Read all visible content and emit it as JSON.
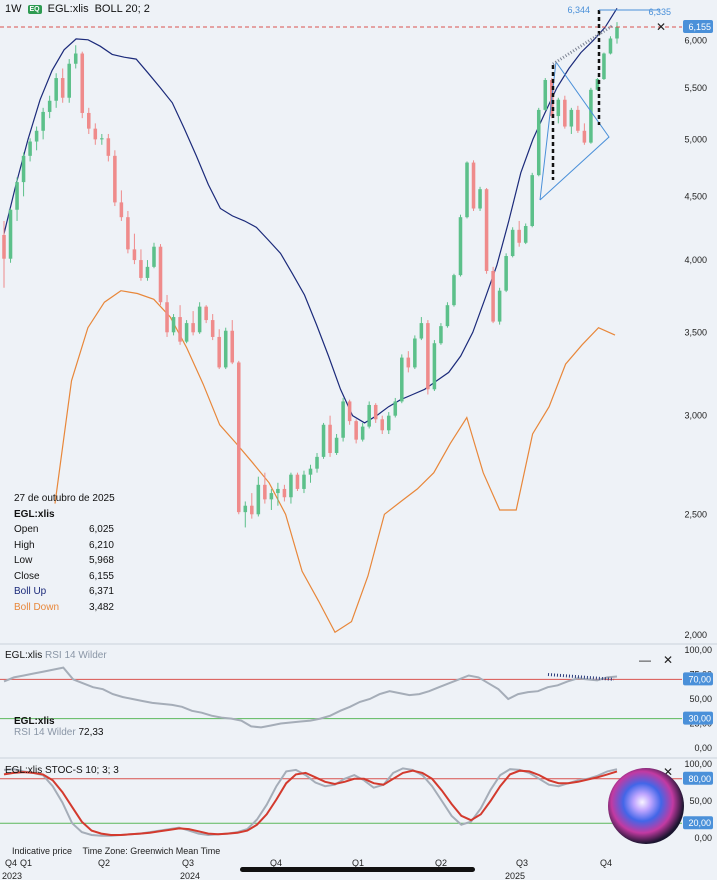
{
  "header": {
    "interval": "1W",
    "badge": "EQ",
    "symbol": "EGL:xlis",
    "indicator": "BOLL 20; 2"
  },
  "price_scale_labels": [
    "6,000",
    "5,500",
    "5,000",
    "4,500",
    "4,000",
    "3,500",
    "3,000",
    "2,500",
    "2,000"
  ],
  "price_tags": {
    "last": "6,155",
    "target_a": "6,344",
    "target_b": "6,335"
  },
  "legend": {
    "date": "27 de outubro de 2025",
    "symbol": "EGL:xlis",
    "rows": [
      {
        "k": "Open",
        "v": "6,025"
      },
      {
        "k": "High",
        "v": "6,210"
      },
      {
        "k": "Low",
        "v": "5,968"
      },
      {
        "k": "Close",
        "v": "6,155"
      },
      {
        "k": "Boll Up",
        "v": "6,371",
        "c": "#1b2a7a"
      },
      {
        "k": "Boll Down",
        "v": "3,482",
        "c": "#e8873a"
      }
    ]
  },
  "rsi_panel": {
    "title_symbol": "EGL:xlis",
    "title_ind": "RSI 14 Wilder",
    "label_symbol": "EGL:xlis",
    "label_ind": "RSI 14 Wilder",
    "value": "72,33",
    "scale": [
      "100,00",
      "75,00",
      "50,00",
      "25,00",
      "0,00"
    ],
    "tag_70": "70,00",
    "tag_30": "30,00"
  },
  "stoch_panel": {
    "title_symbol": "EGL:xlis",
    "title_ind": "STOC-S 10; 3; 3",
    "scale": [
      "100,00",
      "50,00",
      "0,00"
    ],
    "tag_80": "80,00",
    "tag_20": "20,00"
  },
  "footer": {
    "indicative": "Indicative price",
    "tz": "Time Zone: Greenwich Mean Time"
  },
  "x_axis": {
    "labels": [
      "Q4",
      "Q1",
      "Q2",
      "Q3",
      "Q4",
      "Q1",
      "Q2",
      "Q3",
      "Q4"
    ],
    "years": [
      "2023",
      "2024",
      "2025"
    ]
  },
  "colors": {
    "up": "#5cc08a",
    "down": "#ef8b8b",
    "boll_up": "#1b2a7a",
    "boll_down": "#e8873a",
    "rsi": "#a5adb8",
    "level": "#d9534f",
    "level30": "#5cb85c",
    "stoch_k": "#a5adb8",
    "stoch_d": "#d33a2e",
    "accent": "#4a90d9"
  },
  "icons": {
    "close": "close-icon",
    "minimize": "minimize-icon",
    "siri": "siri-orb-icon"
  },
  "chart_data": [
    {
      "type": "candlestick",
      "title": "EGL:xlis",
      "interval": "1W",
      "ylim": [
        2000,
        6200
      ],
      "candles": [
        [
          4190,
          4300,
          3800,
          4010
        ],
        [
          4010,
          4400,
          3980,
          4390
        ],
        [
          4390,
          4660,
          4300,
          4620
        ],
        [
          4620,
          4880,
          4500,
          4850
        ],
        [
          4850,
          5010,
          4800,
          4980
        ],
        [
          4980,
          5120,
          4900,
          5080
        ],
        [
          5080,
          5300,
          5000,
          5260
        ],
        [
          5260,
          5420,
          5200,
          5370
        ],
        [
          5370,
          5650,
          5300,
          5600
        ],
        [
          5600,
          5700,
          5350,
          5400
        ],
        [
          5400,
          5800,
          5350,
          5750
        ],
        [
          5750,
          5950,
          5700,
          5860
        ],
        [
          5860,
          5880,
          5200,
          5250
        ],
        [
          5250,
          5300,
          5050,
          5100
        ],
        [
          5100,
          5150,
          4950,
          5000
        ],
        [
          5000,
          5050,
          4950,
          5010
        ],
        [
          5010,
          5050,
          4800,
          4850
        ],
        [
          4850,
          4900,
          4420,
          4450
        ],
        [
          4450,
          4550,
          4300,
          4330
        ],
        [
          4330,
          4380,
          4050,
          4080
        ],
        [
          4080,
          4200,
          3970,
          4000
        ],
        [
          4000,
          4080,
          3850,
          3870
        ],
        [
          3870,
          4000,
          3850,
          3950
        ],
        [
          3950,
          4130,
          3940,
          4100
        ],
        [
          4100,
          4120,
          3680,
          3700
        ],
        [
          3700,
          3750,
          3470,
          3500
        ],
        [
          3500,
          3620,
          3480,
          3600
        ],
        [
          3600,
          3680,
          3420,
          3440
        ],
        [
          3440,
          3580,
          3430,
          3560
        ],
        [
          3560,
          3640,
          3480,
          3500
        ],
        [
          3500,
          3700,
          3490,
          3670
        ],
        [
          3670,
          3680,
          3560,
          3580
        ],
        [
          3580,
          3620,
          3450,
          3470
        ],
        [
          3470,
          3520,
          3270,
          3280
        ],
        [
          3280,
          3530,
          3270,
          3510
        ],
        [
          3510,
          3580,
          3300,
          3310
        ],
        [
          3310,
          3320,
          2500,
          2510
        ],
        [
          2510,
          2560,
          2440,
          2540
        ],
        [
          2540,
          2600,
          2480,
          2500
        ],
        [
          2500,
          2680,
          2490,
          2640
        ],
        [
          2640,
          2700,
          2550,
          2570
        ],
        [
          2570,
          2620,
          2520,
          2600
        ],
        [
          2600,
          2650,
          2540,
          2620
        ],
        [
          2620,
          2640,
          2560,
          2580
        ],
        [
          2580,
          2700,
          2550,
          2690
        ],
        [
          2690,
          2700,
          2610,
          2620
        ],
        [
          2620,
          2710,
          2600,
          2690
        ],
        [
          2690,
          2740,
          2650,
          2720
        ],
        [
          2720,
          2800,
          2700,
          2780
        ],
        [
          2780,
          2960,
          2770,
          2950
        ],
        [
          2950,
          3000,
          2780,
          2800
        ],
        [
          2800,
          2900,
          2790,
          2880
        ],
        [
          2880,
          3100,
          2860,
          3080
        ],
        [
          3080,
          3090,
          2950,
          2970
        ],
        [
          2970,
          2980,
          2850,
          2870
        ],
        [
          2870,
          2960,
          2860,
          2940
        ],
        [
          2940,
          3080,
          2930,
          3060
        ],
        [
          3060,
          3070,
          2960,
          2980
        ],
        [
          2980,
          3000,
          2900,
          2920
        ],
        [
          2920,
          3020,
          2900,
          3000
        ],
        [
          3000,
          3100,
          2990,
          3080
        ],
        [
          3080,
          3360,
          3070,
          3340
        ],
        [
          3340,
          3380,
          3250,
          3280
        ],
        [
          3280,
          3480,
          3270,
          3460
        ],
        [
          3460,
          3600,
          3450,
          3560
        ],
        [
          3560,
          3580,
          3120,
          3150
        ],
        [
          3150,
          3450,
          3140,
          3430
        ],
        [
          3430,
          3560,
          3420,
          3540
        ],
        [
          3540,
          3700,
          3530,
          3680
        ],
        [
          3680,
          3900,
          3670,
          3890
        ],
        [
          3890,
          4350,
          3880,
          4330
        ],
        [
          4330,
          4800,
          4320,
          4790
        ],
        [
          4790,
          4810,
          4380,
          4400
        ],
        [
          4400,
          4580,
          4380,
          4560
        ],
        [
          4560,
          4570,
          3900,
          3920
        ],
        [
          3920,
          3950,
          3560,
          3570
        ],
        [
          3570,
          3800,
          3550,
          3780
        ],
        [
          3780,
          4050,
          3770,
          4030
        ],
        [
          4030,
          4250,
          4020,
          4230
        ],
        [
          4230,
          4300,
          4100,
          4130
        ],
        [
          4130,
          4280,
          4120,
          4260
        ],
        [
          4260,
          4700,
          4250,
          4680
        ],
        [
          4680,
          5300,
          4670,
          5280
        ],
        [
          5280,
          5600,
          5270,
          5580
        ],
        [
          5580,
          5600,
          5200,
          5220
        ],
        [
          5220,
          5400,
          5150,
          5380
        ],
        [
          5380,
          5420,
          5100,
          5120
        ],
        [
          5120,
          5300,
          5050,
          5280
        ],
        [
          5280,
          5320,
          5060,
          5080
        ],
        [
          5080,
          5150,
          4950,
          4970
        ],
        [
          4970,
          5500,
          4960,
          5480
        ],
        [
          5480,
          5600,
          5470,
          5590
        ],
        [
          5590,
          5870,
          5580,
          5860
        ],
        [
          5860,
          6050,
          5850,
          6025
        ],
        [
          6025,
          6210,
          5968,
          6155
        ]
      ],
      "boll_up": [
        4200,
        4600,
        5000,
        5380,
        5680,
        5900,
        6020,
        6010,
        5940,
        5850,
        5820,
        5800,
        5650,
        5500,
        5350,
        5100,
        4850,
        4600,
        4400,
        4340,
        4300,
        4250,
        4150,
        4050,
        3900,
        3750,
        3550,
        3350,
        3150,
        3000,
        2960,
        3000,
        3050,
        3090,
        3120,
        3150,
        3200,
        3250,
        3350,
        3500,
        3720,
        3960,
        4300,
        4700,
        5000,
        5250,
        5500,
        5700,
        5870,
        6000,
        6150,
        6371
      ],
      "boll_down": [
        2550,
        3200,
        3530,
        3700,
        3780,
        3760,
        3720,
        3600,
        3400,
        3180,
        2950,
        2850,
        2750,
        2650,
        2500,
        2250,
        2130,
        2010,
        2050,
        2230,
        2500,
        2560,
        2620,
        2700,
        2850,
        2990,
        2700,
        2520,
        2520,
        2900,
        3050,
        3300,
        3420,
        3530,
        3482
      ],
      "levels": [
        {
          "value": 6155,
          "style": "dashed",
          "color": "#d9534f"
        }
      ]
    },
    {
      "type": "line",
      "title": "RSI 14 Wilder",
      "ylim": [
        0,
        100
      ],
      "levels": [
        70,
        30
      ],
      "series": [
        {
          "name": "RSI 14 Wilder",
          "values": [
            68,
            72,
            74,
            76,
            78,
            80,
            82,
            70,
            66,
            62,
            60,
            55,
            52,
            50,
            48,
            46,
            45,
            44,
            42,
            38,
            36,
            33,
            31,
            30,
            28,
            22,
            21,
            23,
            25,
            26,
            27,
            28,
            30,
            33,
            38,
            42,
            47,
            50,
            55,
            58,
            56,
            54,
            55,
            58,
            62,
            66,
            70,
            74,
            72,
            66,
            60,
            50,
            55,
            57,
            58,
            62,
            64,
            68,
            71,
            70,
            69,
            72,
            73
          ]
        }
      ]
    },
    {
      "type": "line",
      "title": "STOC-S 10; 3; 3",
      "ylim": [
        0,
        100
      ],
      "levels": [
        80,
        20
      ],
      "series": [
        {
          "name": "%K",
          "values": [
            92,
            93,
            90,
            88,
            85,
            70,
            48,
            20,
            8,
            4,
            3,
            3,
            4,
            5,
            6,
            8,
            10,
            12,
            14,
            10,
            6,
            4,
            5,
            6,
            8,
            12,
            25,
            45,
            70,
            90,
            92,
            85,
            75,
            70,
            72,
            80,
            85,
            78,
            68,
            72,
            88,
            94,
            92,
            85,
            70,
            50,
            30,
            18,
            22,
            40,
            65,
            85,
            93,
            92,
            88,
            80,
            72,
            70,
            74,
            78,
            80,
            84,
            90,
            93
          ]
        },
        {
          "name": "%D",
          "values": [
            86,
            88,
            89,
            88,
            86,
            78,
            62,
            42,
            22,
            10,
            6,
            4,
            4,
            5,
            6,
            7,
            9,
            11,
            13,
            12,
            9,
            6,
            5,
            6,
            7,
            10,
            18,
            32,
            52,
            74,
            86,
            88,
            82,
            76,
            73,
            76,
            80,
            80,
            74,
            72,
            80,
            88,
            91,
            88,
            80,
            64,
            46,
            30,
            24,
            32,
            50,
            70,
            86,
            91,
            90,
            85,
            78,
            74,
            74,
            76,
            79,
            82,
            86,
            90
          ]
        }
      ]
    }
  ]
}
